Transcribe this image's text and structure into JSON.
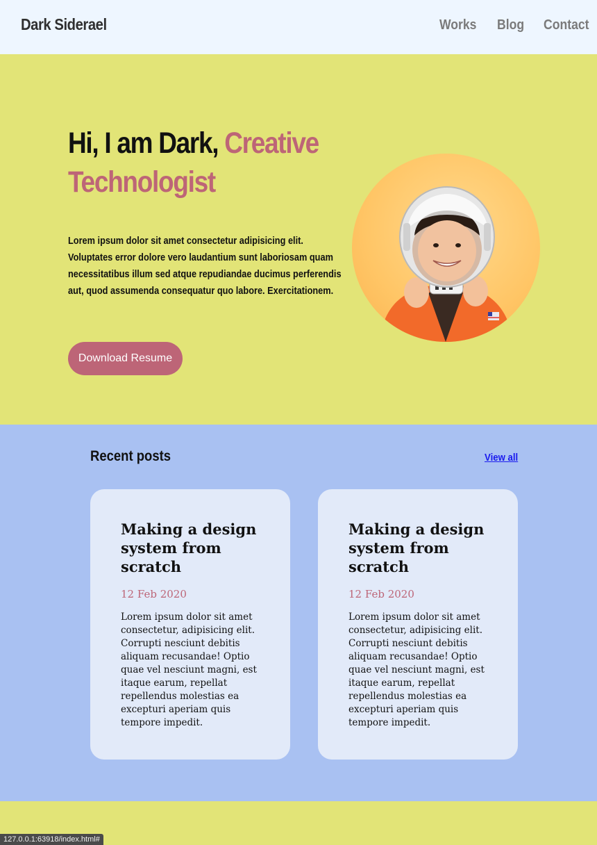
{
  "nav": {
    "brand": "Dark Siderael",
    "links": [
      "Works",
      "Blog",
      "Contact"
    ]
  },
  "hero": {
    "title_plain": "Hi, I am Dark,",
    "title_accent": "Creative Technologist",
    "description": "Lorem ipsum dolor sit amet consectetur adipisicing elit. Voluptates error dolore vero laudantium sunt laboriosam quam necessitatibus illum sed atque repudiandae ducimus perferendis aut, quod assumenda consequatur quo labore. Exercitationem.",
    "button_label": "Download Resume"
  },
  "posts": {
    "heading": "Recent posts",
    "view_all": "View all",
    "items": [
      {
        "title": "Making a design system from scratch",
        "date": "12 Feb 2020",
        "excerpt": "Lorem ipsum dolor sit amet consectetur, adipisicing elit. Corrupti nesciunt debitis aliquam recusandae! Optio quae vel nesciunt magni, est itaque earum, repellat repellendus molestias ea excepturi aperiam quis tempore impedit."
      },
      {
        "title": "Making a design system from scratch",
        "date": "12 Feb 2020",
        "excerpt": "Lorem ipsum dolor sit amet consectetur, adipisicing elit. Corrupti nesciunt debitis aliquam recusandae! Optio quae vel nesciunt magni, est itaque earum, repellat repellendus molestias ea excepturi aperiam quis tempore impedit."
      }
    ]
  },
  "status_bar": "127.0.0.1:63918/index.html#",
  "colors": {
    "accent": "#bd6577",
    "hero_bg": "#e2e477",
    "posts_bg": "#a9c1f2",
    "card_bg": "#e2eaf9",
    "nav_bg": "#eef6ff",
    "link": "#1a1aee"
  }
}
